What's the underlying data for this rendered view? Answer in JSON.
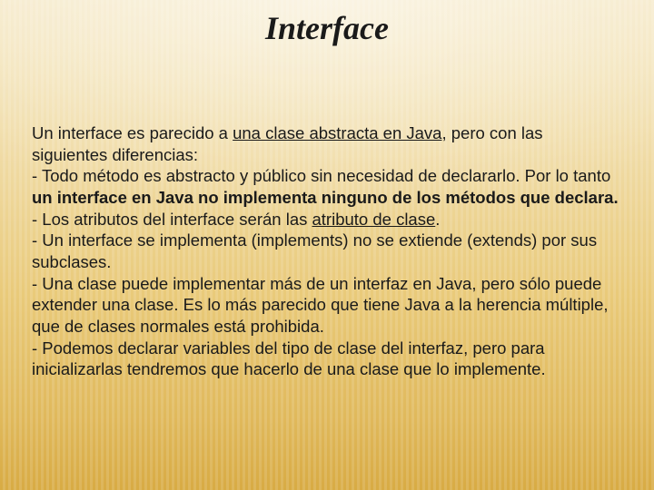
{
  "title": "Interface",
  "p": {
    "intro_a": "Un interface es parecido a ",
    "link1": "una clase abstracta en Java",
    "intro_b": ", pero con las siguientes diferencias:",
    "bullet1_a": "- Todo método es abstracto y público sin necesidad de declararlo. Por lo tanto ",
    "bullet1_bold": "un interface en Java no implementa ninguno de los métodos que declara.",
    "bullet2_a": "- Los atributos del interface serán las ",
    "link2": "atributo de clase",
    "bullet2_b": ".",
    "bullet3": "- Un interface se implementa (implements) no se extiende (extends) por sus subclases.",
    "bullet4": "- Una clase puede implementar más de un interfaz en Java, pero sólo puede extender una clase. Es lo más parecido que tiene Java a la herencia múltiple, que de clases normales está prohibida.",
    "bullet5": "- Podemos declarar variables del tipo de clase del interfaz, pero para inicializarlas tendremos que hacerlo de una clase que lo implemente."
  }
}
